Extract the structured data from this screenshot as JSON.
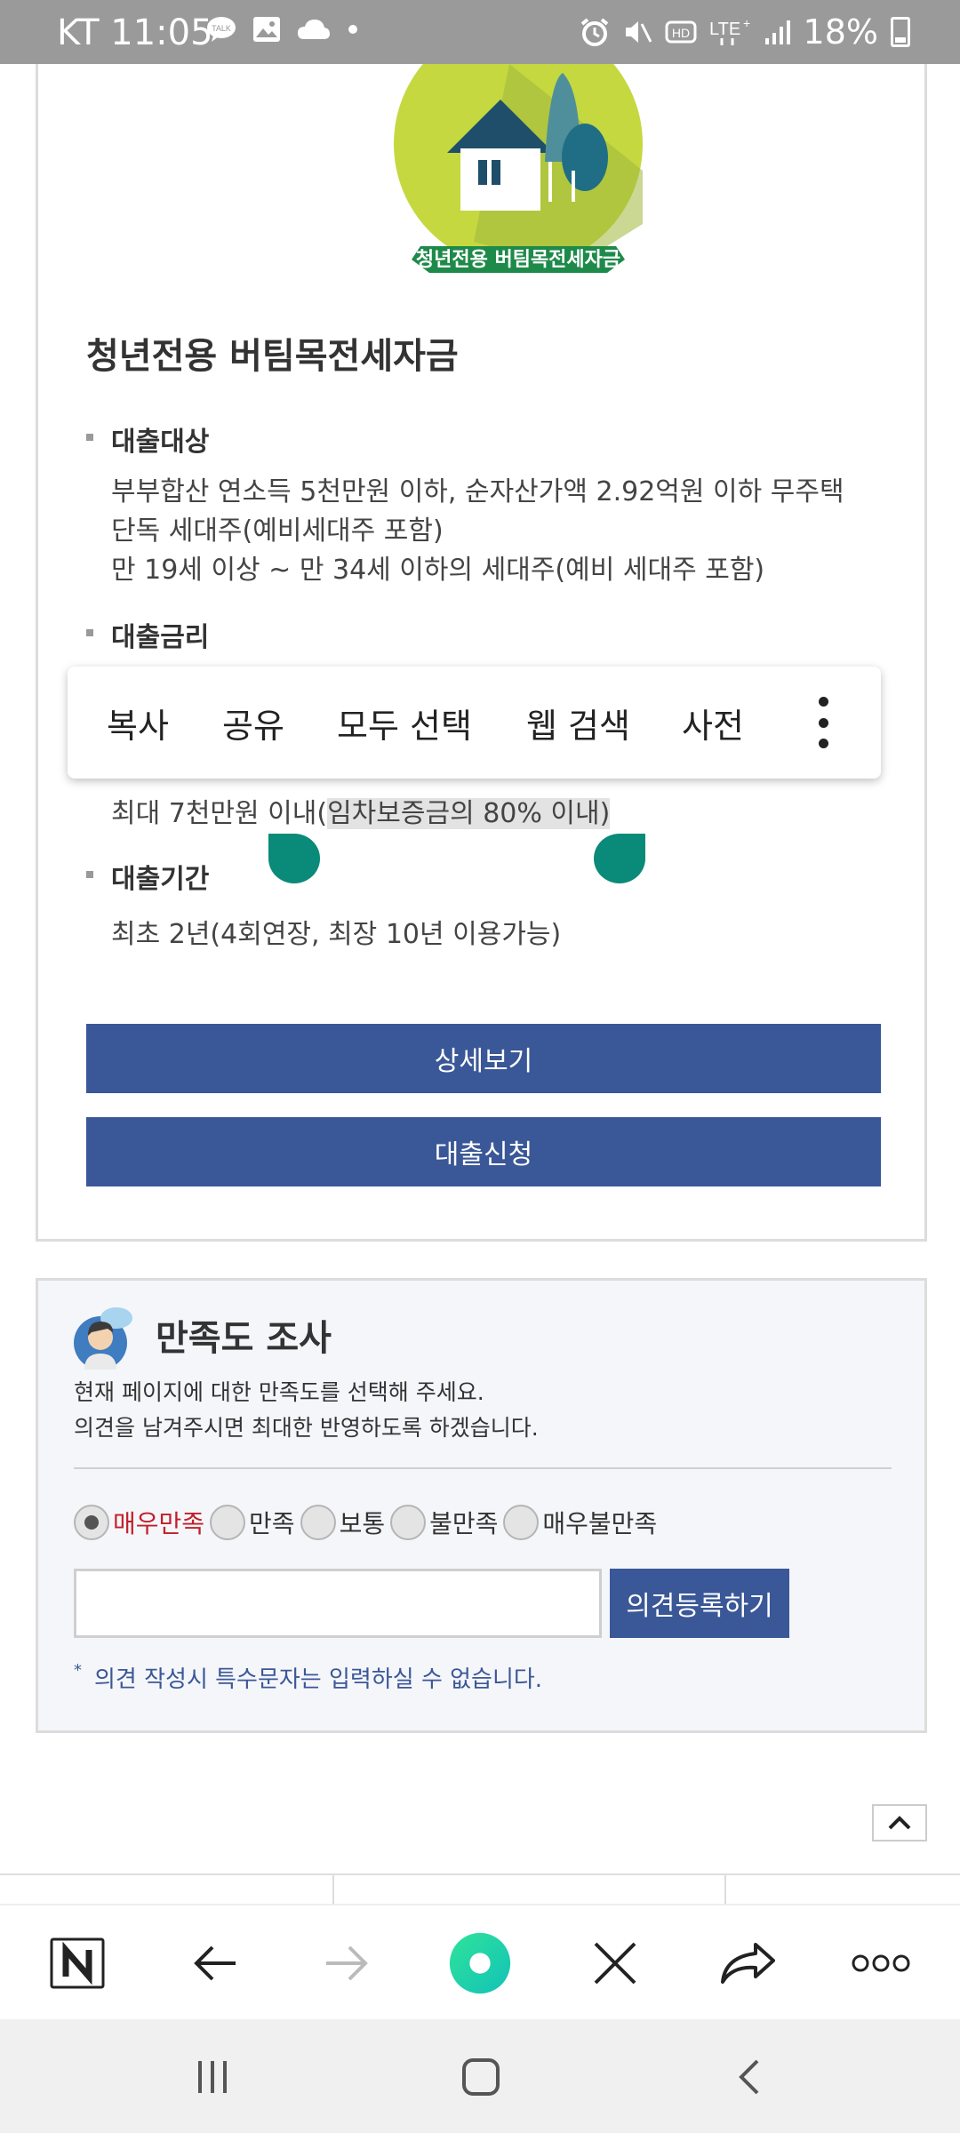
{
  "status_bar": {
    "carrier_time": "KT 11:05",
    "battery": "18%",
    "icons": [
      "talk-icon",
      "gallery-icon",
      "cloud-icon",
      "dot-icon",
      "alarm-icon",
      "mute-icon",
      "hd-icon",
      "lte-icon",
      "signal-icon",
      "battery-icon"
    ]
  },
  "loan": {
    "logo_caption": "청년전용 버팀목전세자금",
    "title": "청년전용 버팀목전세자금",
    "target_label": "대출대상",
    "target_lines": [
      "부부합산 연소득 5천만원 이하, 순자산가액 2.92억원 이하 무주택",
      "단독 세대주(예비세대주 포함)",
      "만 19세 이상 ~ 만 34세 이하의 세대주(예비 세대주 포함)"
    ],
    "rate_label": "대출금리",
    "limit_text_prefix": "최대 7천만원 이내(",
    "limit_text_selected": "임차보증금의 80% 이내)",
    "period_label": "대출기간",
    "period_text": "최초 2년(4회연장, 최장 10년 이용가능)",
    "detail_button": "상세보기",
    "apply_button": "대출신청"
  },
  "context_menu": {
    "items": [
      "복사",
      "공유",
      "모두 선택",
      "웹 검색",
      "사전"
    ]
  },
  "survey": {
    "title": "만족도 조사",
    "desc_line1": "현재 페이지에 대한 만족도를 선택해 주세요.",
    "desc_line2": "의견을 남겨주시면 최대한 반영하도록 하겠습니다.",
    "options": [
      "매우만족",
      "만족",
      "보통",
      "불만족",
      "매우불만족"
    ],
    "selected_option": "매우만족",
    "input_value": "",
    "submit_label": "의견등록하기",
    "note": "의견 작성시 특수문자는 입력하실 수 없습니다.",
    "note_mark": "*"
  },
  "browser_toolbar": {
    "icons": [
      "naver-home-icon",
      "back-icon",
      "forward-icon",
      "green-dot-icon",
      "close-icon",
      "share-icon",
      "more-icon"
    ]
  },
  "nav_bar": {
    "icons": [
      "recent-apps-icon",
      "home-icon",
      "back-icon"
    ]
  },
  "colors": {
    "primary_button": "#3a5797",
    "selection_handle": "#0a8a78",
    "selected_option": "#c0202a",
    "status_bar": "#9a9a9a"
  }
}
